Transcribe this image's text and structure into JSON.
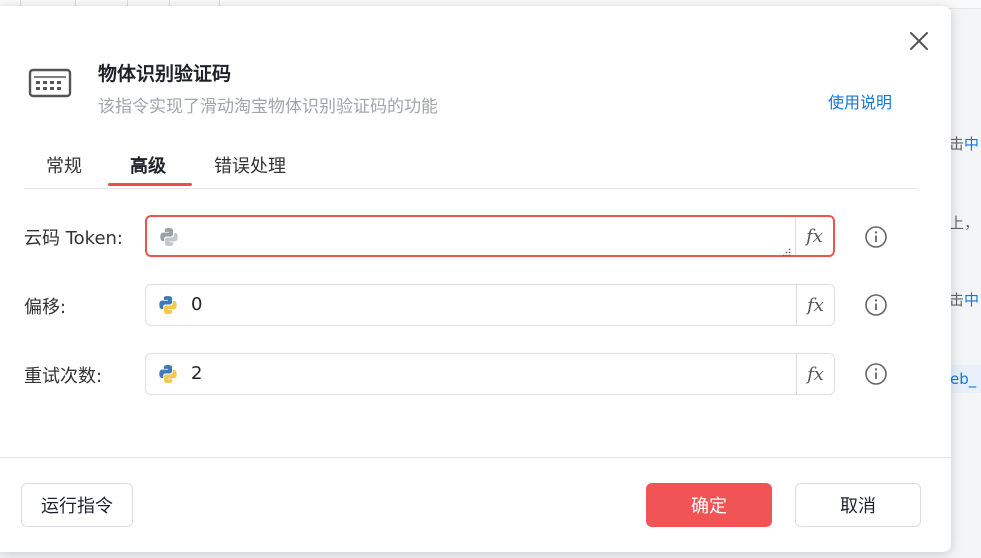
{
  "background": {
    "fragments": [
      "击",
      "中",
      "上，",
      "击",
      "中",
      "eb_"
    ]
  },
  "dialog": {
    "title": "物体识别验证码",
    "subtitle": "该指令实现了滑动淘宝物体识别验证码的功能",
    "help_link": "使用说明",
    "header_icon": "keyboard-icon",
    "close_icon": "close-icon"
  },
  "tabs": [
    {
      "label": "常规",
      "active": false
    },
    {
      "label": "高级",
      "active": true
    },
    {
      "label": "错误处理",
      "active": false
    }
  ],
  "fields": [
    {
      "label": "云码 Token:",
      "value": "",
      "error": true
    },
    {
      "label": "偏移:",
      "value": "0",
      "error": false
    },
    {
      "label": "重试次数:",
      "value": "2",
      "error": false
    }
  ],
  "fx_label": "fx",
  "buttons": {
    "run": "运行指令",
    "ok": "确定",
    "cancel": "取消"
  },
  "colors": {
    "accent": "#f05454",
    "error_border": "#ef5350",
    "link": "#1677d9",
    "python_blue": "#3d7ab8",
    "python_yellow": "#f2c94c"
  }
}
